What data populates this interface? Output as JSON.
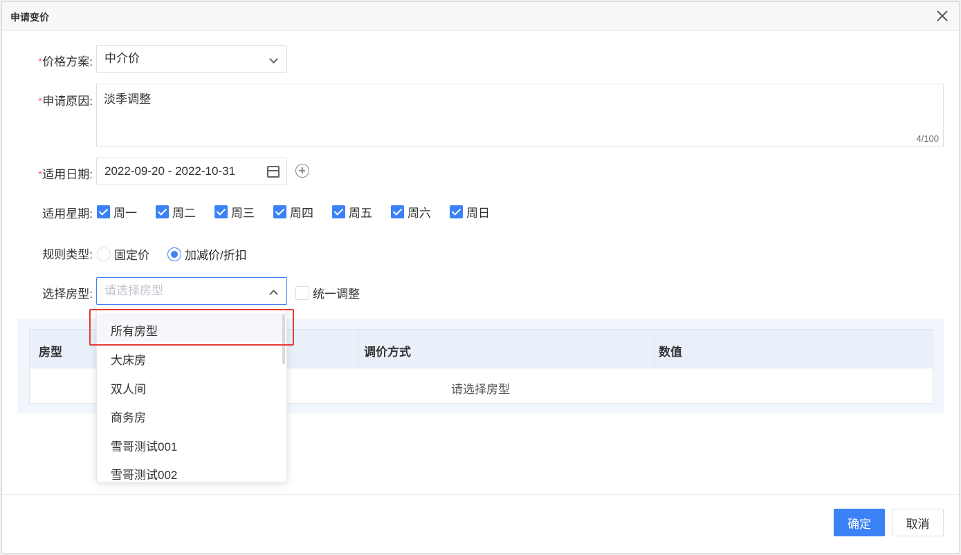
{
  "dialog": {
    "title": "申请变价"
  },
  "form": {
    "price_plan": {
      "label": "价格方案:",
      "value": "中介价"
    },
    "reason": {
      "label": "申请原因:",
      "value": "淡季调整",
      "count": "4/100"
    },
    "date_range": {
      "label": "适用日期:",
      "value": "2022-09-20 - 2022-10-31"
    },
    "weekdays": {
      "label": "适用星期:",
      "items": [
        "周一",
        "周二",
        "周三",
        "周四",
        "周五",
        "周六",
        "周日"
      ]
    },
    "rule_type": {
      "label": "规则类型:",
      "options": [
        "固定价",
        "加减价/折扣"
      ],
      "selected": "加减价/折扣"
    },
    "room_type": {
      "label": "选择房型:",
      "placeholder": "请选择房型",
      "unified_label": "统一调整"
    }
  },
  "dropdown": {
    "options": [
      "所有房型",
      "大床房",
      "双人间",
      "商务房",
      "雪哥测试001",
      "雪哥测试002"
    ]
  },
  "table": {
    "columns": [
      "房型",
      "调价方式",
      "数值"
    ],
    "empty_text": "请选择房型"
  },
  "buttons": {
    "confirm": "确定",
    "cancel": "取消"
  },
  "colors": {
    "primary": "#3b82f6",
    "required": "#f56c6c",
    "highlight_border": "#e53935"
  }
}
